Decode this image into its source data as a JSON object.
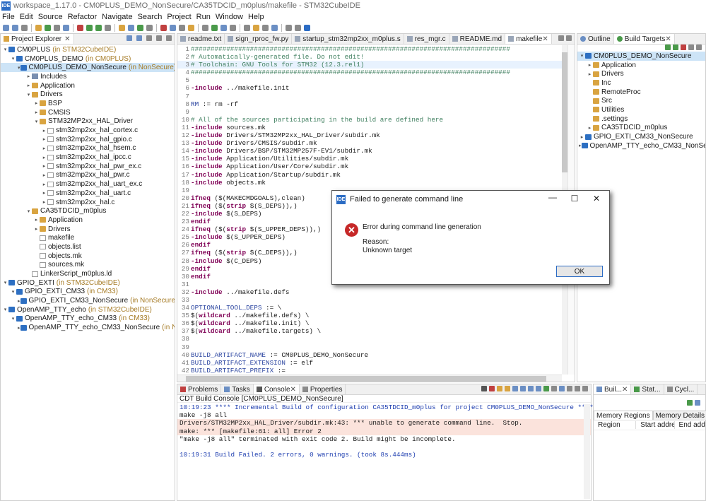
{
  "window": {
    "title": "workspace_1.17.0 - CM0PLUS_DEMO_NonSecure/CA35TDCID_m0plus/makefile - STM32CubeIDE",
    "app_icon": "IDE"
  },
  "menu": [
    "File",
    "Edit",
    "Source",
    "Refactor",
    "Navigate",
    "Search",
    "Project",
    "Run",
    "Window",
    "Help"
  ],
  "project_explorer": {
    "tab_label": "Project Explorer",
    "items": [
      {
        "indent": 0,
        "arrow": "v",
        "icon": "proj",
        "label": "CM0PLUS",
        "annotation": "(in STM32CubeIDE)"
      },
      {
        "indent": 1,
        "arrow": "v",
        "icon": "proj",
        "label": "CM0PLUS_DEMO",
        "annotation": "(in CM0PLUS)"
      },
      {
        "indent": 2,
        "arrow": "v",
        "icon": "proj",
        "label": "CM0PLUS_DEMO_NonSecure",
        "annotation": "(in NonSecure)",
        "selected": true
      },
      {
        "indent": 3,
        "arrow": ">",
        "icon": "pkg",
        "label": "Includes",
        "annotation": ""
      },
      {
        "indent": 3,
        "arrow": ">",
        "icon": "folder",
        "label": "Application",
        "annotation": ""
      },
      {
        "indent": 3,
        "arrow": "v",
        "icon": "folder",
        "label": "Drivers",
        "annotation": ""
      },
      {
        "indent": 4,
        "arrow": ">",
        "icon": "folder",
        "label": "BSP",
        "annotation": ""
      },
      {
        "indent": 4,
        "arrow": ">",
        "icon": "folder",
        "label": "CMSIS",
        "annotation": ""
      },
      {
        "indent": 4,
        "arrow": "v",
        "icon": "folder",
        "label": "STM32MP2xx_HAL_Driver",
        "annotation": ""
      },
      {
        "indent": 5,
        "arrow": ">",
        "icon": "file",
        "label": "stm32mp2xx_hal_cortex.c",
        "annotation": ""
      },
      {
        "indent": 5,
        "arrow": ">",
        "icon": "file",
        "label": "stm32mp2xx_hal_gpio.c",
        "annotation": ""
      },
      {
        "indent": 5,
        "arrow": ">",
        "icon": "file",
        "label": "stm32mp2xx_hal_hsem.c",
        "annotation": ""
      },
      {
        "indent": 5,
        "arrow": ">",
        "icon": "file",
        "label": "stm32mp2xx_hal_ipcc.c",
        "annotation": ""
      },
      {
        "indent": 5,
        "arrow": ">",
        "icon": "file",
        "label": "stm32mp2xx_hal_pwr_ex.c",
        "annotation": ""
      },
      {
        "indent": 5,
        "arrow": ">",
        "icon": "file",
        "label": "stm32mp2xx_hal_pwr.c",
        "annotation": ""
      },
      {
        "indent": 5,
        "arrow": ">",
        "icon": "file",
        "label": "stm32mp2xx_hal_uart_ex.c",
        "annotation": ""
      },
      {
        "indent": 5,
        "arrow": ">",
        "icon": "file",
        "label": "stm32mp2xx_hal_uart.c",
        "annotation": ""
      },
      {
        "indent": 5,
        "arrow": ">",
        "icon": "file",
        "label": "stm32mp2xx_hal.c",
        "annotation": ""
      },
      {
        "indent": 3,
        "arrow": "v",
        "icon": "folder",
        "label": "CA35TDCID_m0plus",
        "annotation": ""
      },
      {
        "indent": 4,
        "arrow": ">",
        "icon": "folder",
        "label": "Application",
        "annotation": ""
      },
      {
        "indent": 4,
        "arrow": ">",
        "icon": "folder",
        "label": "Drivers",
        "annotation": ""
      },
      {
        "indent": 4,
        "arrow": "",
        "icon": "file",
        "label": "makefile",
        "annotation": ""
      },
      {
        "indent": 4,
        "arrow": "",
        "icon": "file",
        "label": "objects.list",
        "annotation": ""
      },
      {
        "indent": 4,
        "arrow": "",
        "icon": "file",
        "label": "objects.mk",
        "annotation": ""
      },
      {
        "indent": 4,
        "arrow": "",
        "icon": "file",
        "label": "sources.mk",
        "annotation": ""
      },
      {
        "indent": 3,
        "arrow": "",
        "icon": "file",
        "label": "LinkerScript_m0plus.ld",
        "annotation": ""
      },
      {
        "indent": 0,
        "arrow": "v",
        "icon": "proj",
        "label": "GPIO_EXTI",
        "annotation": "(in STM32CubeIDE)"
      },
      {
        "indent": 1,
        "arrow": "v",
        "icon": "proj",
        "label": "GPIO_EXTI_CM33",
        "annotation": "(in CM33)"
      },
      {
        "indent": 2,
        "arrow": ">",
        "icon": "proj",
        "label": "GPIO_EXTI_CM33_NonSecure",
        "annotation": "(in NonSecure)"
      },
      {
        "indent": 0,
        "arrow": "v",
        "icon": "proj",
        "label": "OpenAMP_TTY_echo",
        "annotation": "(in STM32CubeIDE)"
      },
      {
        "indent": 1,
        "arrow": "v",
        "icon": "proj",
        "label": "OpenAMP_TTY_echo_CM33",
        "annotation": "(in CM33)"
      },
      {
        "indent": 2,
        "arrow": ">",
        "icon": "proj",
        "label": "OpenAMP_TTY_echo_CM33_NonSecure",
        "annotation": "(in NonSecure)"
      }
    ]
  },
  "editor_tabs": [
    {
      "label": "readme.txt",
      "active": false
    },
    {
      "label": "sign_rproc_fw.py",
      "active": false
    },
    {
      "label": "startup_stm32mp2xx_m0plus.s",
      "active": false
    },
    {
      "label": "res_mgr.c",
      "active": false
    },
    {
      "label": "README.md",
      "active": false
    },
    {
      "label": "makefile",
      "active": true
    }
  ],
  "editor_lines": [
    [
      {
        "t": "#################################################################################",
        "c": "cm"
      }
    ],
    [
      {
        "t": "# Automatically-generated file. Do not edit!",
        "c": "cm"
      }
    ],
    [
      {
        "t": "# Toolchain: GNU Tools for STM32 (12.3.rel1)",
        "c": "cm"
      }
    ],
    [
      {
        "t": "#################################################################################",
        "c": "cm"
      }
    ],
    [],
    [
      {
        "t": "-include",
        "c": "kw"
      },
      {
        "t": " ../makefile.init",
        "c": ""
      }
    ],
    [],
    [
      {
        "t": "RM",
        "c": "vr"
      },
      {
        "t": " := rm -rf",
        "c": ""
      }
    ],
    [],
    [
      {
        "t": "# All of the sources participating in the build are defined here",
        "c": "cm"
      }
    ],
    [
      {
        "t": "-include",
        "c": "kw"
      },
      {
        "t": " sources.mk",
        "c": ""
      }
    ],
    [
      {
        "t": "-include",
        "c": "kw"
      },
      {
        "t": " Drivers/STM32MP2xx_HAL_Driver/subdir.mk",
        "c": ""
      }
    ],
    [
      {
        "t": "-include",
        "c": "kw"
      },
      {
        "t": " Drivers/CMSIS/subdir.mk",
        "c": ""
      }
    ],
    [
      {
        "t": "-include",
        "c": "kw"
      },
      {
        "t": " Drivers/BSP/STM32MP257F-EV1/subdir.mk",
        "c": ""
      }
    ],
    [
      {
        "t": "-include",
        "c": "kw"
      },
      {
        "t": " Application/Utilities/subdir.mk",
        "c": ""
      }
    ],
    [
      {
        "t": "-include",
        "c": "kw"
      },
      {
        "t": " Application/User/Core/subdir.mk",
        "c": ""
      }
    ],
    [
      {
        "t": "-include",
        "c": "kw"
      },
      {
        "t": " Application/Startup/subdir.mk",
        "c": ""
      }
    ],
    [
      {
        "t": "-include",
        "c": "kw"
      },
      {
        "t": " objects.mk",
        "c": ""
      }
    ],
    [],
    [
      {
        "t": "ifneq",
        "c": "kw"
      },
      {
        "t": " ($(MAKECMDGOALS),clean)",
        "c": ""
      }
    ],
    [
      {
        "t": "ifneq",
        "c": "kw"
      },
      {
        "t": " ($(",
        "c": ""
      },
      {
        "t": "strip",
        "c": "kw"
      },
      {
        "t": " $(S_DEPS)),)",
        "c": ""
      }
    ],
    [
      {
        "t": "-include",
        "c": "kw"
      },
      {
        "t": " $(S_DEPS)",
        "c": ""
      }
    ],
    [
      {
        "t": "endif",
        "c": "kw"
      }
    ],
    [
      {
        "t": "ifneq",
        "c": "kw"
      },
      {
        "t": " ($(",
        "c": ""
      },
      {
        "t": "strip",
        "c": "kw"
      },
      {
        "t": " $(S_UPPER_DEPS)),)",
        "c": ""
      }
    ],
    [
      {
        "t": "-include",
        "c": "kw"
      },
      {
        "t": " $(S_UPPER_DEPS)",
        "c": ""
      }
    ],
    [
      {
        "t": "endif",
        "c": "kw"
      }
    ],
    [
      {
        "t": "ifneq",
        "c": "kw"
      },
      {
        "t": " ($(",
        "c": ""
      },
      {
        "t": "strip",
        "c": "kw"
      },
      {
        "t": " $(C_DEPS)),)",
        "c": ""
      }
    ],
    [
      {
        "t": "-include",
        "c": "kw"
      },
      {
        "t": " $(C_DEPS)",
        "c": ""
      }
    ],
    [
      {
        "t": "endif",
        "c": "kw"
      }
    ],
    [
      {
        "t": "endif",
        "c": "kw"
      }
    ],
    [],
    [
      {
        "t": "-include",
        "c": "kw"
      },
      {
        "t": " ../makefile.defs",
        "c": ""
      }
    ],
    [],
    [
      {
        "t": "OPTIONAL_TOOL_DEPS",
        "c": "vr"
      },
      {
        "t": " := \\",
        "c": ""
      }
    ],
    [
      {
        "t": "$(",
        "c": ""
      },
      {
        "t": "wildcard",
        "c": "kw"
      },
      {
        "t": " ../makefile.defs) \\",
        "c": ""
      }
    ],
    [
      {
        "t": "$(",
        "c": ""
      },
      {
        "t": "wildcard",
        "c": "kw"
      },
      {
        "t": " ../makefile.init) \\",
        "c": ""
      }
    ],
    [
      {
        "t": "$(",
        "c": ""
      },
      {
        "t": "wildcard",
        "c": "kw"
      },
      {
        "t": " ../makefile.targets) \\",
        "c": ""
      }
    ],
    [],
    [],
    [
      {
        "t": "BUILD_ARTIFACT_NAME",
        "c": "vr"
      },
      {
        "t": " := CM0PLUS_DEMO_NonSecure",
        "c": ""
      }
    ],
    [
      {
        "t": "BUILD_ARTIFACT_EXTENSION",
        "c": "vr"
      },
      {
        "t": " := elf",
        "c": ""
      }
    ],
    [
      {
        "t": "BUILD_ARTIFACT_PREFIX",
        "c": "vr"
      },
      {
        "t": " :=",
        "c": ""
      }
    ]
  ],
  "outline_panel": {
    "tabs": [
      {
        "label": "Outline",
        "active": false
      },
      {
        "label": "Build Targets",
        "active": true
      }
    ],
    "items": [
      {
        "indent": 0,
        "arrow": "v",
        "icon": "proj",
        "label": "CM0PLUS_DEMO_NonSecure",
        "selected": true
      },
      {
        "indent": 1,
        "arrow": ">",
        "icon": "folder",
        "label": "Application"
      },
      {
        "indent": 1,
        "arrow": ">",
        "icon": "folder",
        "label": "Drivers"
      },
      {
        "indent": 1,
        "arrow": "",
        "icon": "folder",
        "label": "Inc"
      },
      {
        "indent": 1,
        "arrow": "",
        "icon": "folder",
        "label": "RemoteProc"
      },
      {
        "indent": 1,
        "arrow": "",
        "icon": "folder",
        "label": "Src"
      },
      {
        "indent": 1,
        "arrow": "",
        "icon": "folder",
        "label": "Utilities"
      },
      {
        "indent": 1,
        "arrow": "",
        "icon": "folder",
        "label": ".settings"
      },
      {
        "indent": 1,
        "arrow": ">",
        "icon": "folder",
        "label": "CA35TDCID_m0plus"
      },
      {
        "indent": 0,
        "arrow": ">",
        "icon": "proj",
        "label": "GPIO_EXTI_CM33_NonSecure"
      },
      {
        "indent": 0,
        "arrow": ">",
        "icon": "proj",
        "label": "OpenAMP_TTY_echo_CM33_NonSecure"
      }
    ]
  },
  "bottom_tabs": [
    {
      "label": "Problems",
      "active": false
    },
    {
      "label": "Tasks",
      "active": false
    },
    {
      "label": "Console",
      "active": true
    },
    {
      "label": "Properties",
      "active": false
    }
  ],
  "console": {
    "header": "CDT Build Console [CM0PLUS_DEMO_NonSecure]",
    "lines": [
      {
        "text": "10:19:23 **** Incremental Build of configuration CA35TDCID_m0plus for project CM0PLUS_DEMO_NonSecure ****",
        "style": "blue"
      },
      {
        "text": "make -j8 all",
        "style": ""
      },
      {
        "text": "Drivers/STM32MP2xx_HAL_Driver/subdir.mk:43: *** unable to generate command line.  Stop.",
        "style": "err"
      },
      {
        "text": "make: *** [makefile:61: all] Error 2",
        "style": "err"
      },
      {
        "text": "\"make -j8 all\" terminated with exit code 2. Build might be incomplete.",
        "style": ""
      },
      {
        "text": "",
        "style": ""
      },
      {
        "text": "10:19:31 Build Failed. 2 errors, 0 warnings. (took 8s.444ms)",
        "style": "blue"
      }
    ]
  },
  "right_bottom": {
    "tabs": [
      "Buil...",
      "Stat...",
      "Cycl..."
    ],
    "subtabs": [
      {
        "label": "Memory Regions",
        "active": true
      },
      {
        "label": "Memory Details",
        "active": false
      }
    ],
    "columns": [
      "Region",
      "Start address",
      "End addre"
    ]
  },
  "dialog": {
    "title": "Failed to generate command line",
    "message": "Error during command line generation",
    "reason_label": "Reason:",
    "reason": "Unknown target",
    "ok": "OK",
    "icon_glyph": "✕"
  },
  "colors": {
    "accent": "#2c6cc4",
    "error": "#c62828",
    "keyword": "#7f0055",
    "comment": "#3f7f5f",
    "variable": "#2b45a0",
    "error_bg": "#fbe3dc",
    "annotation": "#a57a24"
  }
}
